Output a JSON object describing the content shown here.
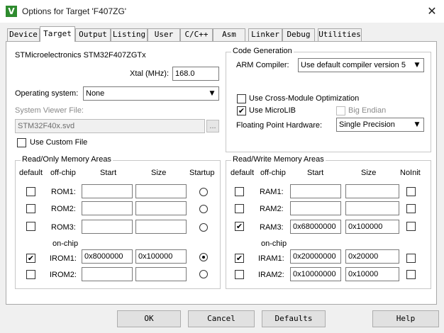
{
  "window": {
    "title": "Options for Target 'F407ZG'",
    "icon_glyph": "V",
    "close_glyph": "✕"
  },
  "tabs": [
    {
      "label": "Device"
    },
    {
      "label": "Target"
    },
    {
      "label": "Output"
    },
    {
      "label": "Listing"
    },
    {
      "label": "User"
    },
    {
      "label": "C/C++"
    },
    {
      "label": "Asm"
    },
    {
      "label": "Linker"
    },
    {
      "label": "Debug"
    },
    {
      "label": "Utilities"
    }
  ],
  "active_tab": "Target",
  "target": {
    "device_name": "STMicroelectronics STM32F407ZGTx",
    "xtal_label": "Xtal (MHz):",
    "xtal_value": "168.0",
    "os_label": "Operating system:",
    "os_value": "None",
    "svf_label": "System Viewer File:",
    "svf_value": "STM32F40x.svd",
    "browse_label": "...",
    "use_custom_file_label": "Use Custom File",
    "use_custom_file_checked": false
  },
  "code_generation": {
    "title": "Code Generation",
    "compiler_label": "ARM Compiler:",
    "compiler_value": "Use default compiler version 5",
    "cross_module_label": "Use Cross-Module Optimization",
    "cross_module_checked": false,
    "microlib_label": "Use MicroLIB",
    "microlib_checked": true,
    "big_endian_label": "Big Endian",
    "big_endian_checked": false,
    "fpu_label": "Floating Point Hardware:",
    "fpu_value": "Single Precision"
  },
  "rom_area": {
    "title": "Read/Only Memory Areas",
    "headers": {
      "default": "default",
      "offchip": "off-chip",
      "start": "Start",
      "size": "Size",
      "startup": "Startup"
    },
    "onchip_label": "on-chip",
    "rows": [
      {
        "name": "ROM1:",
        "default": false,
        "start": "",
        "size": "",
        "startup": false
      },
      {
        "name": "ROM2:",
        "default": false,
        "start": "",
        "size": "",
        "startup": false
      },
      {
        "name": "ROM3:",
        "default": false,
        "start": "",
        "size": "",
        "startup": false
      },
      {
        "name": "IROM1:",
        "default": true,
        "start": "0x8000000",
        "size": "0x100000",
        "startup": true
      },
      {
        "name": "IROM2:",
        "default": false,
        "start": "",
        "size": "",
        "startup": false
      }
    ]
  },
  "ram_area": {
    "title": "Read/Write Memory Areas",
    "headers": {
      "default": "default",
      "offchip": "off-chip",
      "start": "Start",
      "size": "Size",
      "noinit": "NoInit"
    },
    "onchip_label": "on-chip",
    "rows": [
      {
        "name": "RAM1:",
        "default": false,
        "start": "",
        "size": "",
        "noinit": false
      },
      {
        "name": "RAM2:",
        "default": false,
        "start": "",
        "size": "",
        "noinit": false
      },
      {
        "name": "RAM3:",
        "default": true,
        "start": "0x68000000",
        "size": "0x100000",
        "noinit": false
      },
      {
        "name": "IRAM1:",
        "default": true,
        "start": "0x20000000",
        "size": "0x20000",
        "noinit": false
      },
      {
        "name": "IRAM2:",
        "default": false,
        "start": "0x10000000",
        "size": "0x10000",
        "noinit": false
      }
    ]
  },
  "buttons": {
    "ok": "OK",
    "cancel": "Cancel",
    "defaults": "Defaults",
    "help": "Help"
  },
  "glyphs": {
    "check": "✔",
    "dropdown": "▼"
  }
}
